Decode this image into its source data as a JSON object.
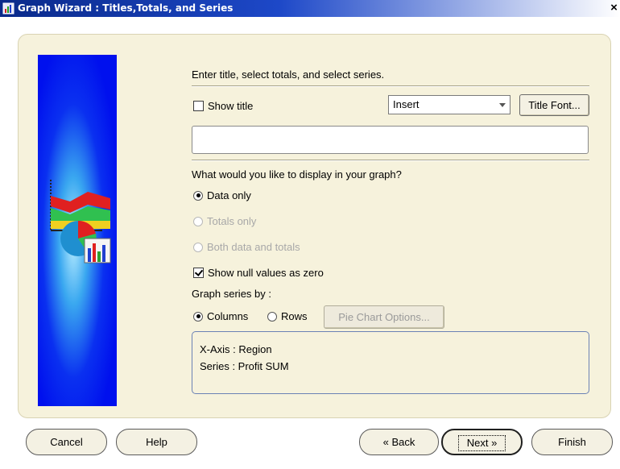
{
  "window": {
    "title": "Graph Wizard : Titles,Totals, and Series",
    "close_glyph": "×"
  },
  "instructions": "Enter title, select totals, and select series.",
  "title_section": {
    "show_title_label": "Show title",
    "show_title_checked": false,
    "position_select_value": "Insert",
    "title_font_button": "Title Font...",
    "title_input_value": ""
  },
  "display": {
    "question": "What would you like to display in your graph?",
    "options": [
      {
        "label": "Data only",
        "selected": true,
        "enabled": true
      },
      {
        "label": "Totals only",
        "selected": false,
        "enabled": false
      },
      {
        "label": "Both data and totals",
        "selected": false,
        "enabled": false
      }
    ],
    "show_null_label": "Show null values as zero",
    "show_null_checked": true
  },
  "series": {
    "label": "Graph series by :",
    "columns_label": "Columns",
    "rows_label": "Rows",
    "selected": "Columns",
    "pie_options_button": "Pie Chart Options..."
  },
  "info": {
    "x_axis": "X-Axis  : Region",
    "series": "Series : Profit SUM"
  },
  "footer": {
    "cancel": "Cancel",
    "help": "Help",
    "back": "Back",
    "back_glyph": "«",
    "next": "Next",
    "next_glyph": "»",
    "finish": "Finish"
  },
  "icons": {
    "app": "graph-wizard-app-icon",
    "artwork": "chart-illustration"
  },
  "colors": {
    "titlebar": "#0a2a8a",
    "panel": "#f6f2dc",
    "artwork_bg": "#0010ee"
  }
}
